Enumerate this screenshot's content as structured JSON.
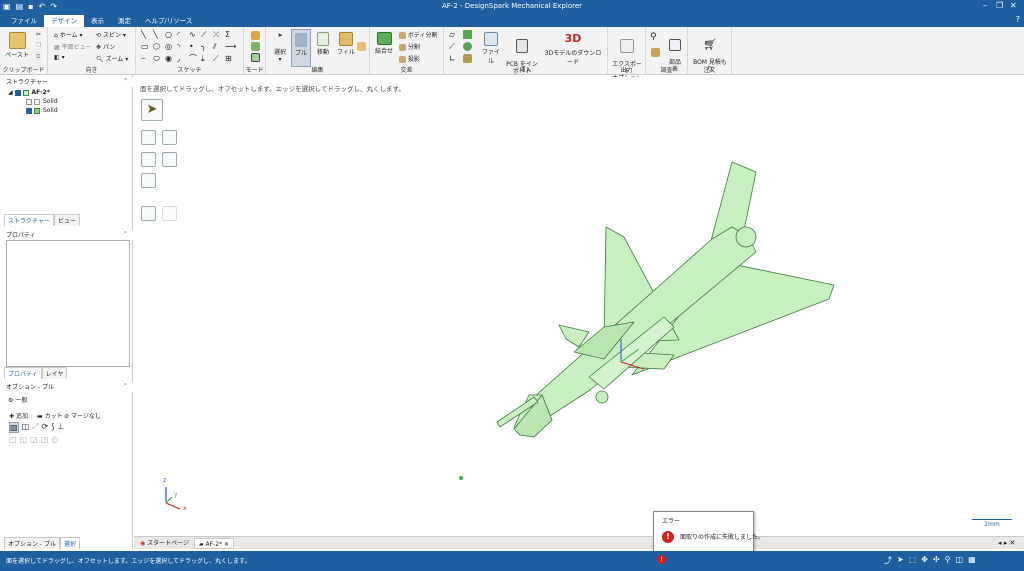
{
  "window": {
    "title": "AF-2 - DesignSpark Mechanical Explorer"
  },
  "menu": {
    "tabs": [
      "ファイル",
      "デザイン",
      "表示",
      "測定",
      "ヘルプ/リソース"
    ],
    "active": 1
  },
  "ribbon": {
    "clipboard": {
      "label": "クリップボード",
      "paste": "ペースト"
    },
    "orient": {
      "label": "向き",
      "home": "ホーム",
      "plane_view": "平面ビュー",
      "spin": "スピン",
      "pan": "パン",
      "zoom": "ズーム"
    },
    "sketch": {
      "label": "スケッチ"
    },
    "mode": {
      "label": "モード"
    },
    "edit": {
      "label": "編集",
      "select": "選択",
      "pull": "プル",
      "move": "移動",
      "fill": "フィル"
    },
    "intersect": {
      "label": "交差",
      "combine": "結合せ",
      "split_body": "ボディ分割",
      "split": "分割",
      "project": "投影"
    },
    "insert": {
      "label": "挿入",
      "file": "ファイル",
      "pcb_import": "PCB をイン\nポート",
      "download_3d": "3Dモデルのダウンロード",
      "badge_3d": "3D"
    },
    "output": {
      "label": "出力",
      "export_options": "エクスポート\nオプション"
    },
    "investigate": {
      "label": "調査",
      "parts_table": "部品\n表"
    },
    "order": {
      "label": "注文",
      "bom_quote": "BOM 見積も\nり"
    }
  },
  "structure_panel": {
    "title": "ストラクチャー",
    "root": "AF-2*",
    "items": [
      "Solid",
      "Solid"
    ],
    "tabs": [
      "ストラクチャー",
      "ビュー"
    ]
  },
  "properties_panel": {
    "title": "プロパティ",
    "tabs": [
      "プロパティ",
      "レイヤ"
    ]
  },
  "options_panel": {
    "title": "オプション - プル",
    "section": "一般",
    "options": [
      "追加",
      "カット",
      "マージなし"
    ],
    "tabs": [
      "オプション - プル",
      "選択"
    ]
  },
  "viewport": {
    "hint": "面を選択してドラッグし、オフセットします。エッジを選択してドラッグし、丸くします。",
    "scale_label": "2mm",
    "axes": {
      "x": "x",
      "y": "y",
      "z": "z"
    }
  },
  "doc_tabs": [
    "スタートページ",
    "AF-2*"
  ],
  "error": {
    "title": "エラー",
    "message": "面取りの作成に失敗しました。"
  },
  "status": {
    "message": "面を選択してドラッグし、オフセットします。エッジを選択してドラッグし、丸くします。"
  },
  "colors": {
    "accent": "#1f5fa0",
    "model_fill": "#c8efc0",
    "model_stroke": "#3d7a3d",
    "error": "#d42020"
  }
}
